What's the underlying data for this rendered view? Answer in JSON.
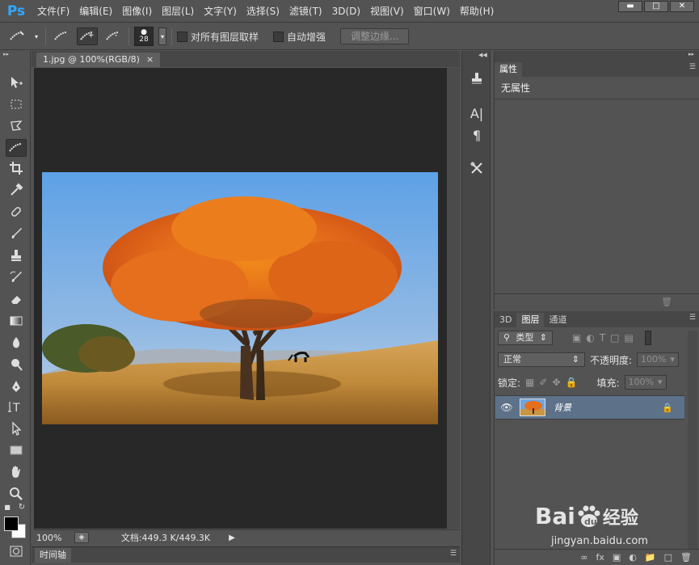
{
  "app": {
    "logo": "Ps"
  },
  "menu": [
    "文件(F)",
    "编辑(E)",
    "图像(I)",
    "图层(L)",
    "文字(Y)",
    "选择(S)",
    "滤镜(T)",
    "3D(D)",
    "视图(V)",
    "窗口(W)",
    "帮助(H)"
  ],
  "window_buttons": [
    "minimize-icon",
    "restore-icon",
    "close-icon"
  ],
  "options": {
    "brush_size": "28",
    "sample_all_layers_label": "对所有图层取样",
    "auto_enhance_label": "自动增强",
    "refine_edge_label": "调整边缘..."
  },
  "tools": [
    "move-icon",
    "marquee-icon",
    "lasso-icon",
    "quick-selection-icon",
    "crop-icon",
    "eyedropper-icon",
    "healing-brush-icon",
    "brush-icon",
    "clone-stamp-icon",
    "history-brush-icon",
    "eraser-icon",
    "gradient-icon",
    "blur-icon",
    "dodge-icon",
    "pen-icon",
    "type-icon",
    "path-selection-icon",
    "rectangle-icon",
    "hand-icon",
    "zoom-icon"
  ],
  "colors": {
    "foreground": "#000000",
    "background": "#ffffff",
    "selection": "#5d7189",
    "logo": "#31a8ff"
  },
  "document": {
    "tab_title": "1.jpg @ 100%(RGB/8)",
    "tab_close": "×",
    "zoom": "100%",
    "doc_info": "文档:449.3 K/449.3K"
  },
  "timeline": {
    "label": "时间轴"
  },
  "properties_panel": {
    "tab_label": "属性",
    "content": "无属性"
  },
  "layers_panel": {
    "tabs": [
      "3D",
      "图层",
      "通道"
    ],
    "active_tab": "图层",
    "filter_label": "类型",
    "blend_mode": "正常",
    "opacity_label": "不透明度:",
    "opacity_value": "100%",
    "lock_label": "锁定:",
    "fill_label": "填充:",
    "fill_value": "100%",
    "layers": [
      {
        "name": "背景",
        "visible": true,
        "locked": true
      }
    ],
    "footer_fx": "fx"
  },
  "watermark": {
    "brand": "Bai",
    "paw": "du",
    "brand2": "经验",
    "url": "jingyan.baidu.com"
  }
}
